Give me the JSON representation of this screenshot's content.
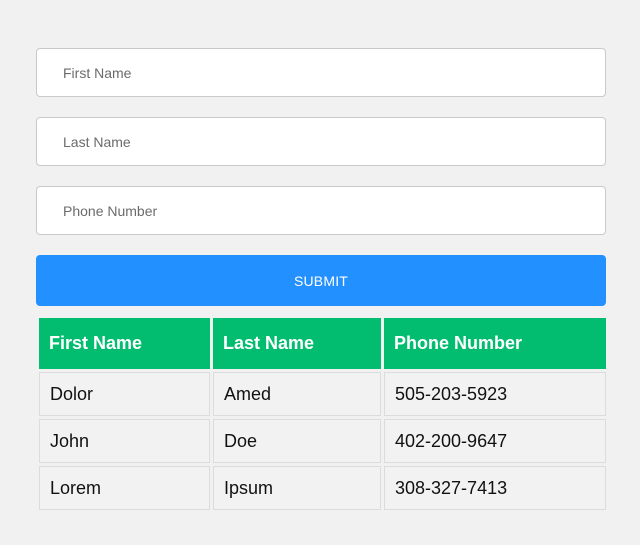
{
  "form": {
    "first_name_placeholder": "First Name",
    "last_name_placeholder": "Last Name",
    "phone_placeholder": "Phone Number",
    "submit_label": "SUBMIT"
  },
  "table": {
    "headers": [
      "First Name",
      "Last Name",
      "Phone Number"
    ],
    "rows": [
      [
        "Dolor",
        "Amed",
        "505-203-5923"
      ],
      [
        "John",
        "Doe",
        "402-200-9647"
      ],
      [
        "Lorem",
        "Ipsum",
        "308-327-7413"
      ]
    ]
  },
  "colors": {
    "page_background": "#f1f1f1",
    "submit_button": "#2290ff",
    "table_header": "#02bc70",
    "table_cell": "#f2f2f2"
  }
}
